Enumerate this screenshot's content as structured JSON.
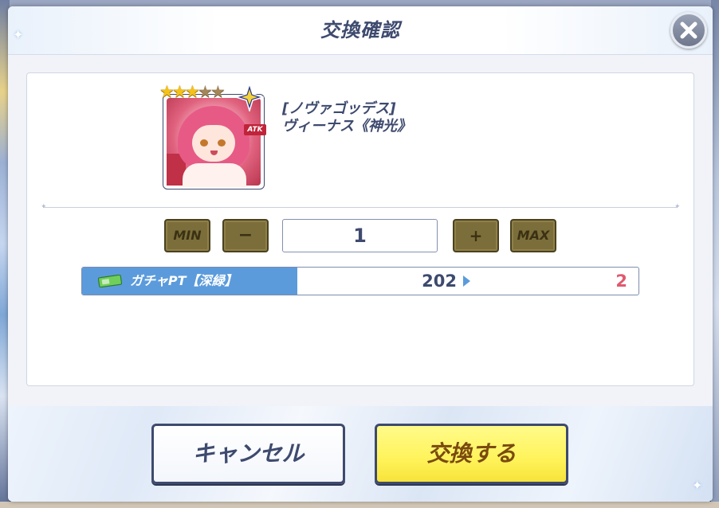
{
  "dialog": {
    "title": "交換確認",
    "close_icon": "close-icon"
  },
  "item": {
    "name_line1": "[ノヴァゴッデス]",
    "name_line2": "ヴィーナス《神光》",
    "rarity_stars_filled": 3,
    "rarity_stars_total": 5,
    "badge_label": "ATK"
  },
  "quantity": {
    "min_label": "MIN",
    "minus_label": "−",
    "value": "1",
    "plus_label": "+",
    "max_label": "MAX"
  },
  "currency": {
    "label": "ガチャPT【深緑】",
    "icon": "ticket-icon",
    "current": "202",
    "after": "2"
  },
  "footer": {
    "cancel_label": "キャンセル",
    "confirm_label": "交換する"
  },
  "colors": {
    "accent": "#3e4a6e",
    "currency_bar": "#5b9bdc",
    "after_value": "#e05a6e",
    "confirm_bg": "#fff35a"
  }
}
